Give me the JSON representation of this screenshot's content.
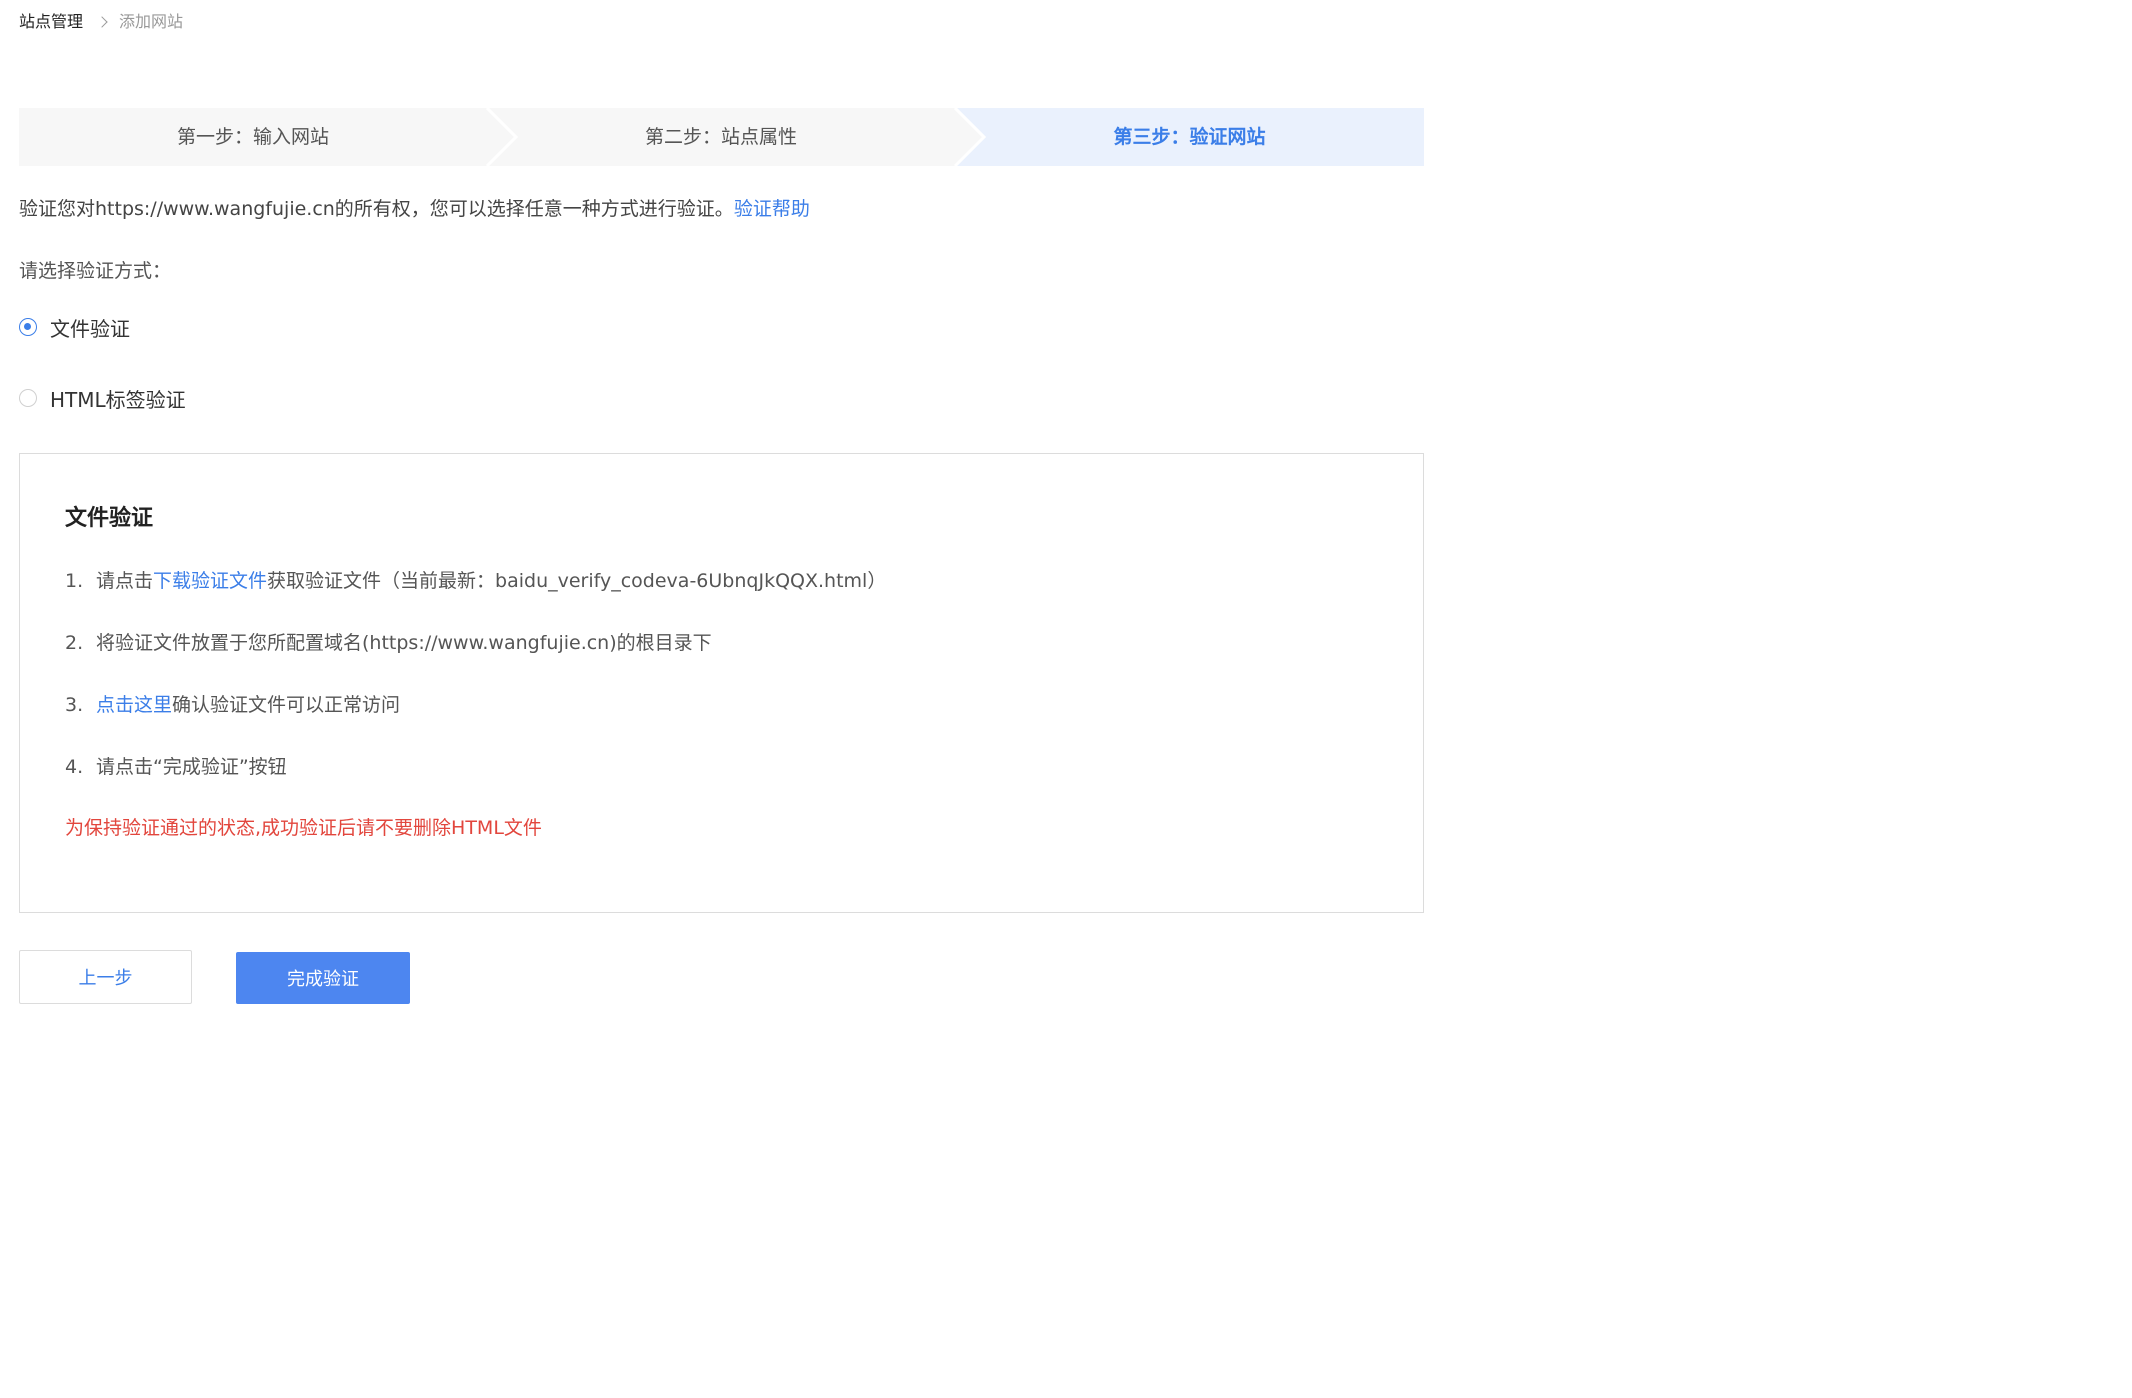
{
  "breadcrumb": {
    "root": "站点管理",
    "current": "添加网站"
  },
  "steps": [
    {
      "label": "第一步：输入网站",
      "active": false
    },
    {
      "label": "第二步：站点属性",
      "active": false
    },
    {
      "label": "第三步：验证网站",
      "active": true
    }
  ],
  "intro": {
    "text": "验证您对https://www.wangfujie.cn的所有权，您可以选择任意一种方式进行验证。",
    "help_link": "验证帮助"
  },
  "choose_label": "请选择验证方式：",
  "methods": [
    {
      "label": "文件验证",
      "selected": true
    },
    {
      "label": "HTML标签验证",
      "selected": false
    }
  ],
  "panel": {
    "title": "文件验证",
    "steps": [
      {
        "num": "1.",
        "pre": "请点击",
        "link": "下载验证文件",
        "post": "获取验证文件（当前最新：baidu_verify_codeva-6UbnqJkQQX.html）"
      },
      {
        "num": "2.",
        "pre": "将验证文件放置于您所配置域名(https://www.wangfujie.cn)的根目录下",
        "link": "",
        "post": ""
      },
      {
        "num": "3.",
        "pre": "",
        "link": "点击这里",
        "post": "确认验证文件可以正常访问"
      },
      {
        "num": "4.",
        "pre": "请点击“完成验证”按钮",
        "link": "",
        "post": ""
      }
    ],
    "warning": "为保持验证通过的状态,成功验证后请不要删除HTML文件"
  },
  "buttons": {
    "prev": "上一步",
    "done": "完成验证"
  },
  "colors": {
    "accent": "#3b7ee8",
    "primary_button": "#4d86f0",
    "warning": "#e2463d",
    "step_bg": "#f7f7f7",
    "step_active_bg": "#eaf1fd"
  }
}
